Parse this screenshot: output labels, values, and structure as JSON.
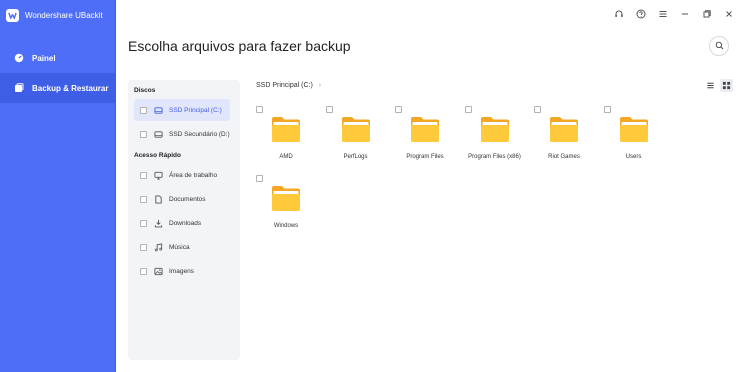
{
  "app": {
    "title": "Wondershare UBackit"
  },
  "sidebar": {
    "items": [
      {
        "label": "Painel",
        "icon": "dashboard-icon"
      },
      {
        "label": "Backup & Restaurar",
        "icon": "backup-icon"
      }
    ]
  },
  "titlebar": {
    "icons": [
      "headset-icon",
      "help-icon",
      "menu-icon",
      "minimize-icon",
      "restore-icon",
      "close-icon"
    ]
  },
  "page": {
    "title": "Escolha arquivos para fazer backup"
  },
  "tree": {
    "disks_label": "Discos",
    "disks": [
      {
        "label": "SSD Principal (C:)",
        "selected": true
      },
      {
        "label": "SSD Secundário (D:)",
        "selected": false
      }
    ],
    "quick_label": "Acesso Rápido",
    "quick": [
      {
        "label": "Área de trabalho",
        "icon": "desktop-icon"
      },
      {
        "label": "Documentos",
        "icon": "document-icon"
      },
      {
        "label": "Downloads",
        "icon": "download-icon"
      },
      {
        "label": "Música",
        "icon": "music-icon"
      },
      {
        "label": "Imagens",
        "icon": "image-icon"
      }
    ]
  },
  "path": {
    "current": "SSD Principal (C:)"
  },
  "folders": [
    {
      "name": "AMD"
    },
    {
      "name": "PerfLogs"
    },
    {
      "name": "Program Files"
    },
    {
      "name": "Program Files (x86)"
    },
    {
      "name": "Riot Games"
    },
    {
      "name": "Users"
    },
    {
      "name": "Windows"
    }
  ],
  "colors": {
    "accent": "#4f6ef7",
    "folder": "#ffc93c",
    "folder_dark": "#f5a623"
  }
}
